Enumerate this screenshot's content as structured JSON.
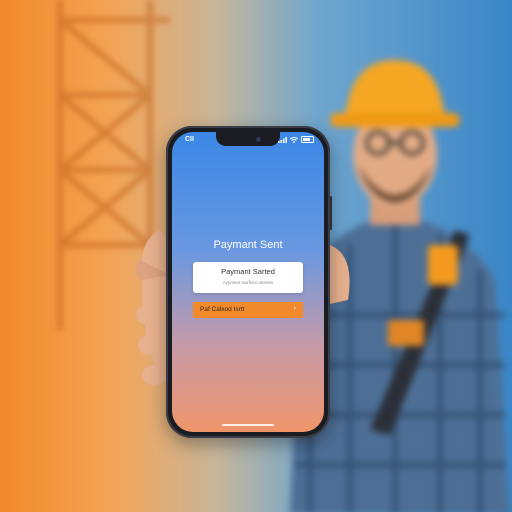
{
  "status_bar": {
    "time": "CII",
    "icons": [
      "signal-icon",
      "wifi-icon",
      "battery-icon"
    ]
  },
  "payment": {
    "title": "Paymant Sent",
    "card_title": "Paymant Sarted",
    "card_subtitle": "Ayyment worfioro semtes",
    "action_label": "Paf Calkod Isrtt",
    "action_icon": "chevron-right-icon"
  },
  "colors": {
    "screen_top": "#3b87e6",
    "screen_bottom": "#f0956a",
    "accent_orange": "#f28a2c",
    "hardhat": "#f5a623"
  }
}
